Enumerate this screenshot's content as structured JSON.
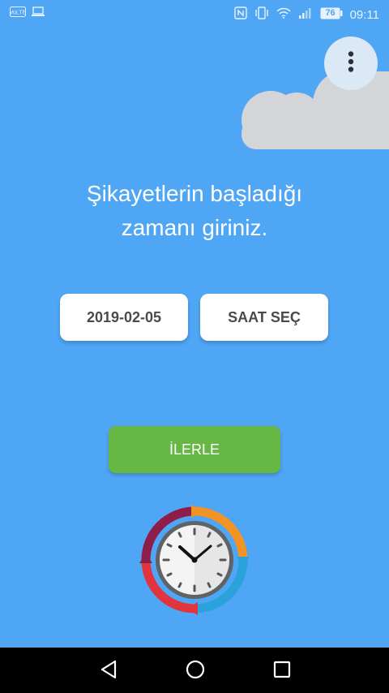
{
  "status_bar": {
    "time": "09:11",
    "battery": "76"
  },
  "main": {
    "headline_line1": "Şikayetlerin başladığı",
    "headline_line2": "zamanı giriniz.",
    "date_button": "2019-02-05",
    "time_button": "SAAT SEÇ",
    "next_button": "İLERLE"
  },
  "colors": {
    "background": "#4fa6f4",
    "next_button": "#67b744",
    "cloud": "#d3d5d8"
  }
}
